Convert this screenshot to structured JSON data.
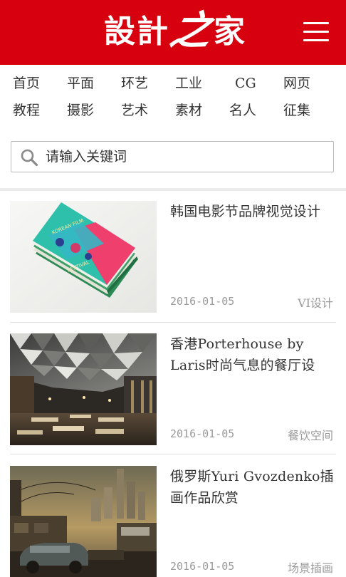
{
  "header": {
    "logo_chars": [
      "設",
      "計",
      "之",
      "家"
    ],
    "bg_color": "#d7000f"
  },
  "nav": {
    "items": [
      "首页",
      "平面",
      "环艺",
      "工业",
      "CG",
      "网页",
      "教程",
      "摄影",
      "艺术",
      "素材",
      "名人",
      "征集"
    ]
  },
  "search": {
    "placeholder": "请输入关键词"
  },
  "articles": [
    {
      "title": "韩国电影节品牌视觉设计",
      "date": "2016-01-05",
      "category": "VI设计"
    },
    {
      "title": "香港Porterhouse by Laris时尚气息的餐厅设",
      "date": "2016-01-05",
      "category": "餐饮空间"
    },
    {
      "title": "俄罗斯Yuri Gvozdenko插画作品欣赏",
      "date": "2016-01-05",
      "category": "场景插画"
    }
  ]
}
